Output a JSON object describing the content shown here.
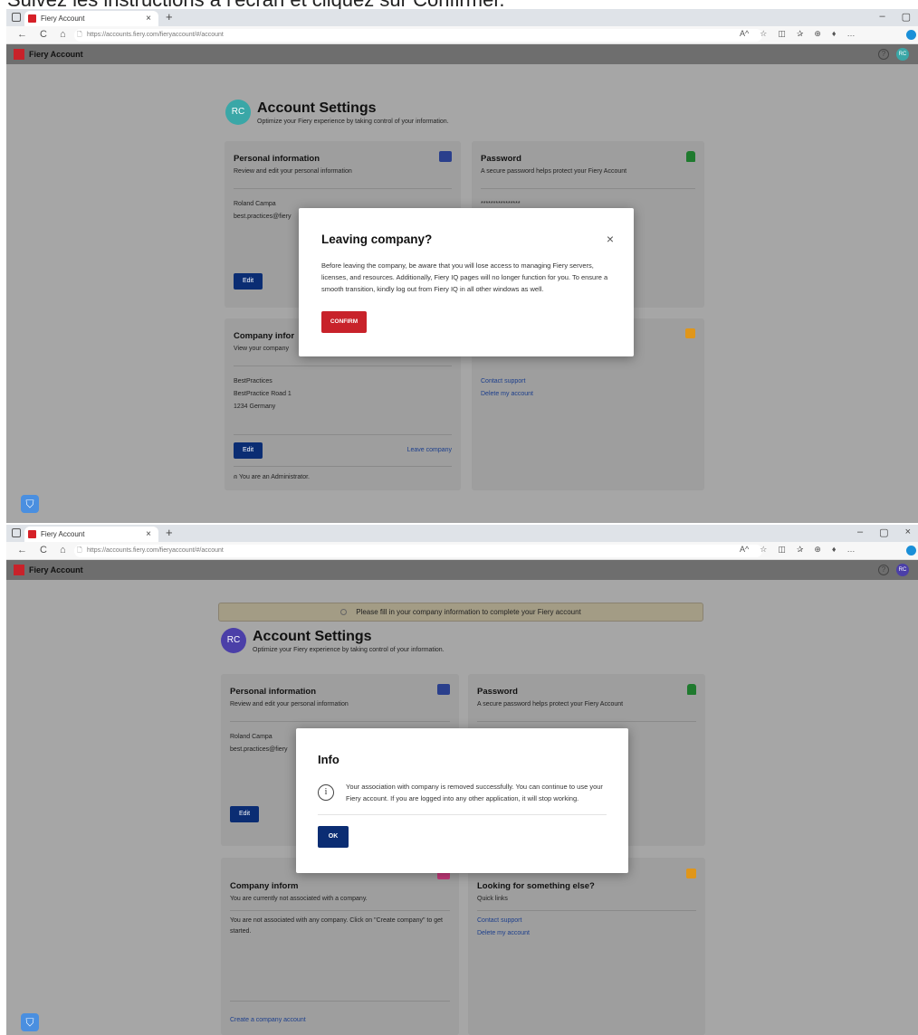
{
  "caption": "Suivez les instructions à l'écran et cliquez sur Confirmer.",
  "browser": {
    "tab_title": "Fiery Account",
    "tab_close": "×",
    "new_tab": "+",
    "url": "https://accounts.fiery.com/fieryaccount/#/account",
    "win_min": "–",
    "win_max": "▢",
    "win_close": "×",
    "tools": [
      "A^",
      "☆",
      "◫",
      "✰",
      "⊕",
      "♦",
      "…"
    ]
  },
  "app": {
    "name": "Fiery Account",
    "help": "?",
    "avatar_initials": "RC"
  },
  "colors": {
    "avatar_teal": "#3aa7a7",
    "avatar_purple": "#4b3fa8",
    "brand_red": "#c8222a",
    "brand_navy": "#0b2d73",
    "lock_green": "#1f7a2e",
    "help_orange": "#e0961a"
  },
  "screen1": {
    "account": {
      "initials": "RC",
      "title": "Account Settings",
      "subtitle": "Optimize your Fiery experience by taking control of your information."
    },
    "personal": {
      "title": "Personal information",
      "subtitle": "Review and edit your personal information",
      "name": "Roland Campa",
      "email": "best.practices@fiery",
      "edit": "Edit"
    },
    "password": {
      "title": "Password",
      "subtitle": "A secure password helps protect your Fiery Account",
      "masked": "****************"
    },
    "company": {
      "title": "Company infor",
      "subtitle": "View your company",
      "line1": "BestPractices",
      "line2": "BestPractice Road 1",
      "line3": "1234 Germany",
      "edit": "Edit",
      "leave": "Leave company",
      "role": "You are an Administrator."
    },
    "links": {
      "contact": "Contact support",
      "delete": "Delete my account"
    },
    "modal": {
      "title": "Leaving company?",
      "close": "×",
      "body": "Before leaving the company, be aware that you will lose access to managing Fiery servers, licenses, and resources. Additionally, Fiery IQ pages will no longer function for you. To ensure a smooth transition, kindly log out from Fiery IQ in all other windows as well.",
      "confirm": "CONFIRM"
    }
  },
  "screen2": {
    "banner": "Please fill in your company information to complete your Fiery account",
    "account": {
      "initials": "RC",
      "title": "Account Settings",
      "subtitle": "Optimize your Fiery experience by taking control of your information."
    },
    "personal": {
      "title": "Personal information",
      "subtitle": "Review and edit your personal information",
      "name": "Roland Campa",
      "email": "best.practices@fiery",
      "edit": "Edit"
    },
    "password": {
      "title": "Password",
      "subtitle": "A secure password helps protect your Fiery Account"
    },
    "company": {
      "title": "Company inform",
      "subtitle": "You are currently not associated with a company.",
      "text": "You are not associated with any company. Click on \"Create company\" to get started.",
      "create": "Create a company account"
    },
    "quick": {
      "title": "Looking for something else?",
      "subtitle": "Quick links",
      "contact": "Contact support",
      "delete": "Delete my account"
    },
    "modal": {
      "title": "Info",
      "icon": "i",
      "body": "Your association with company is removed successfully. You can continue to use your Fiery account. If you are logged into any other application, it will stop working.",
      "ok": "OK"
    }
  }
}
